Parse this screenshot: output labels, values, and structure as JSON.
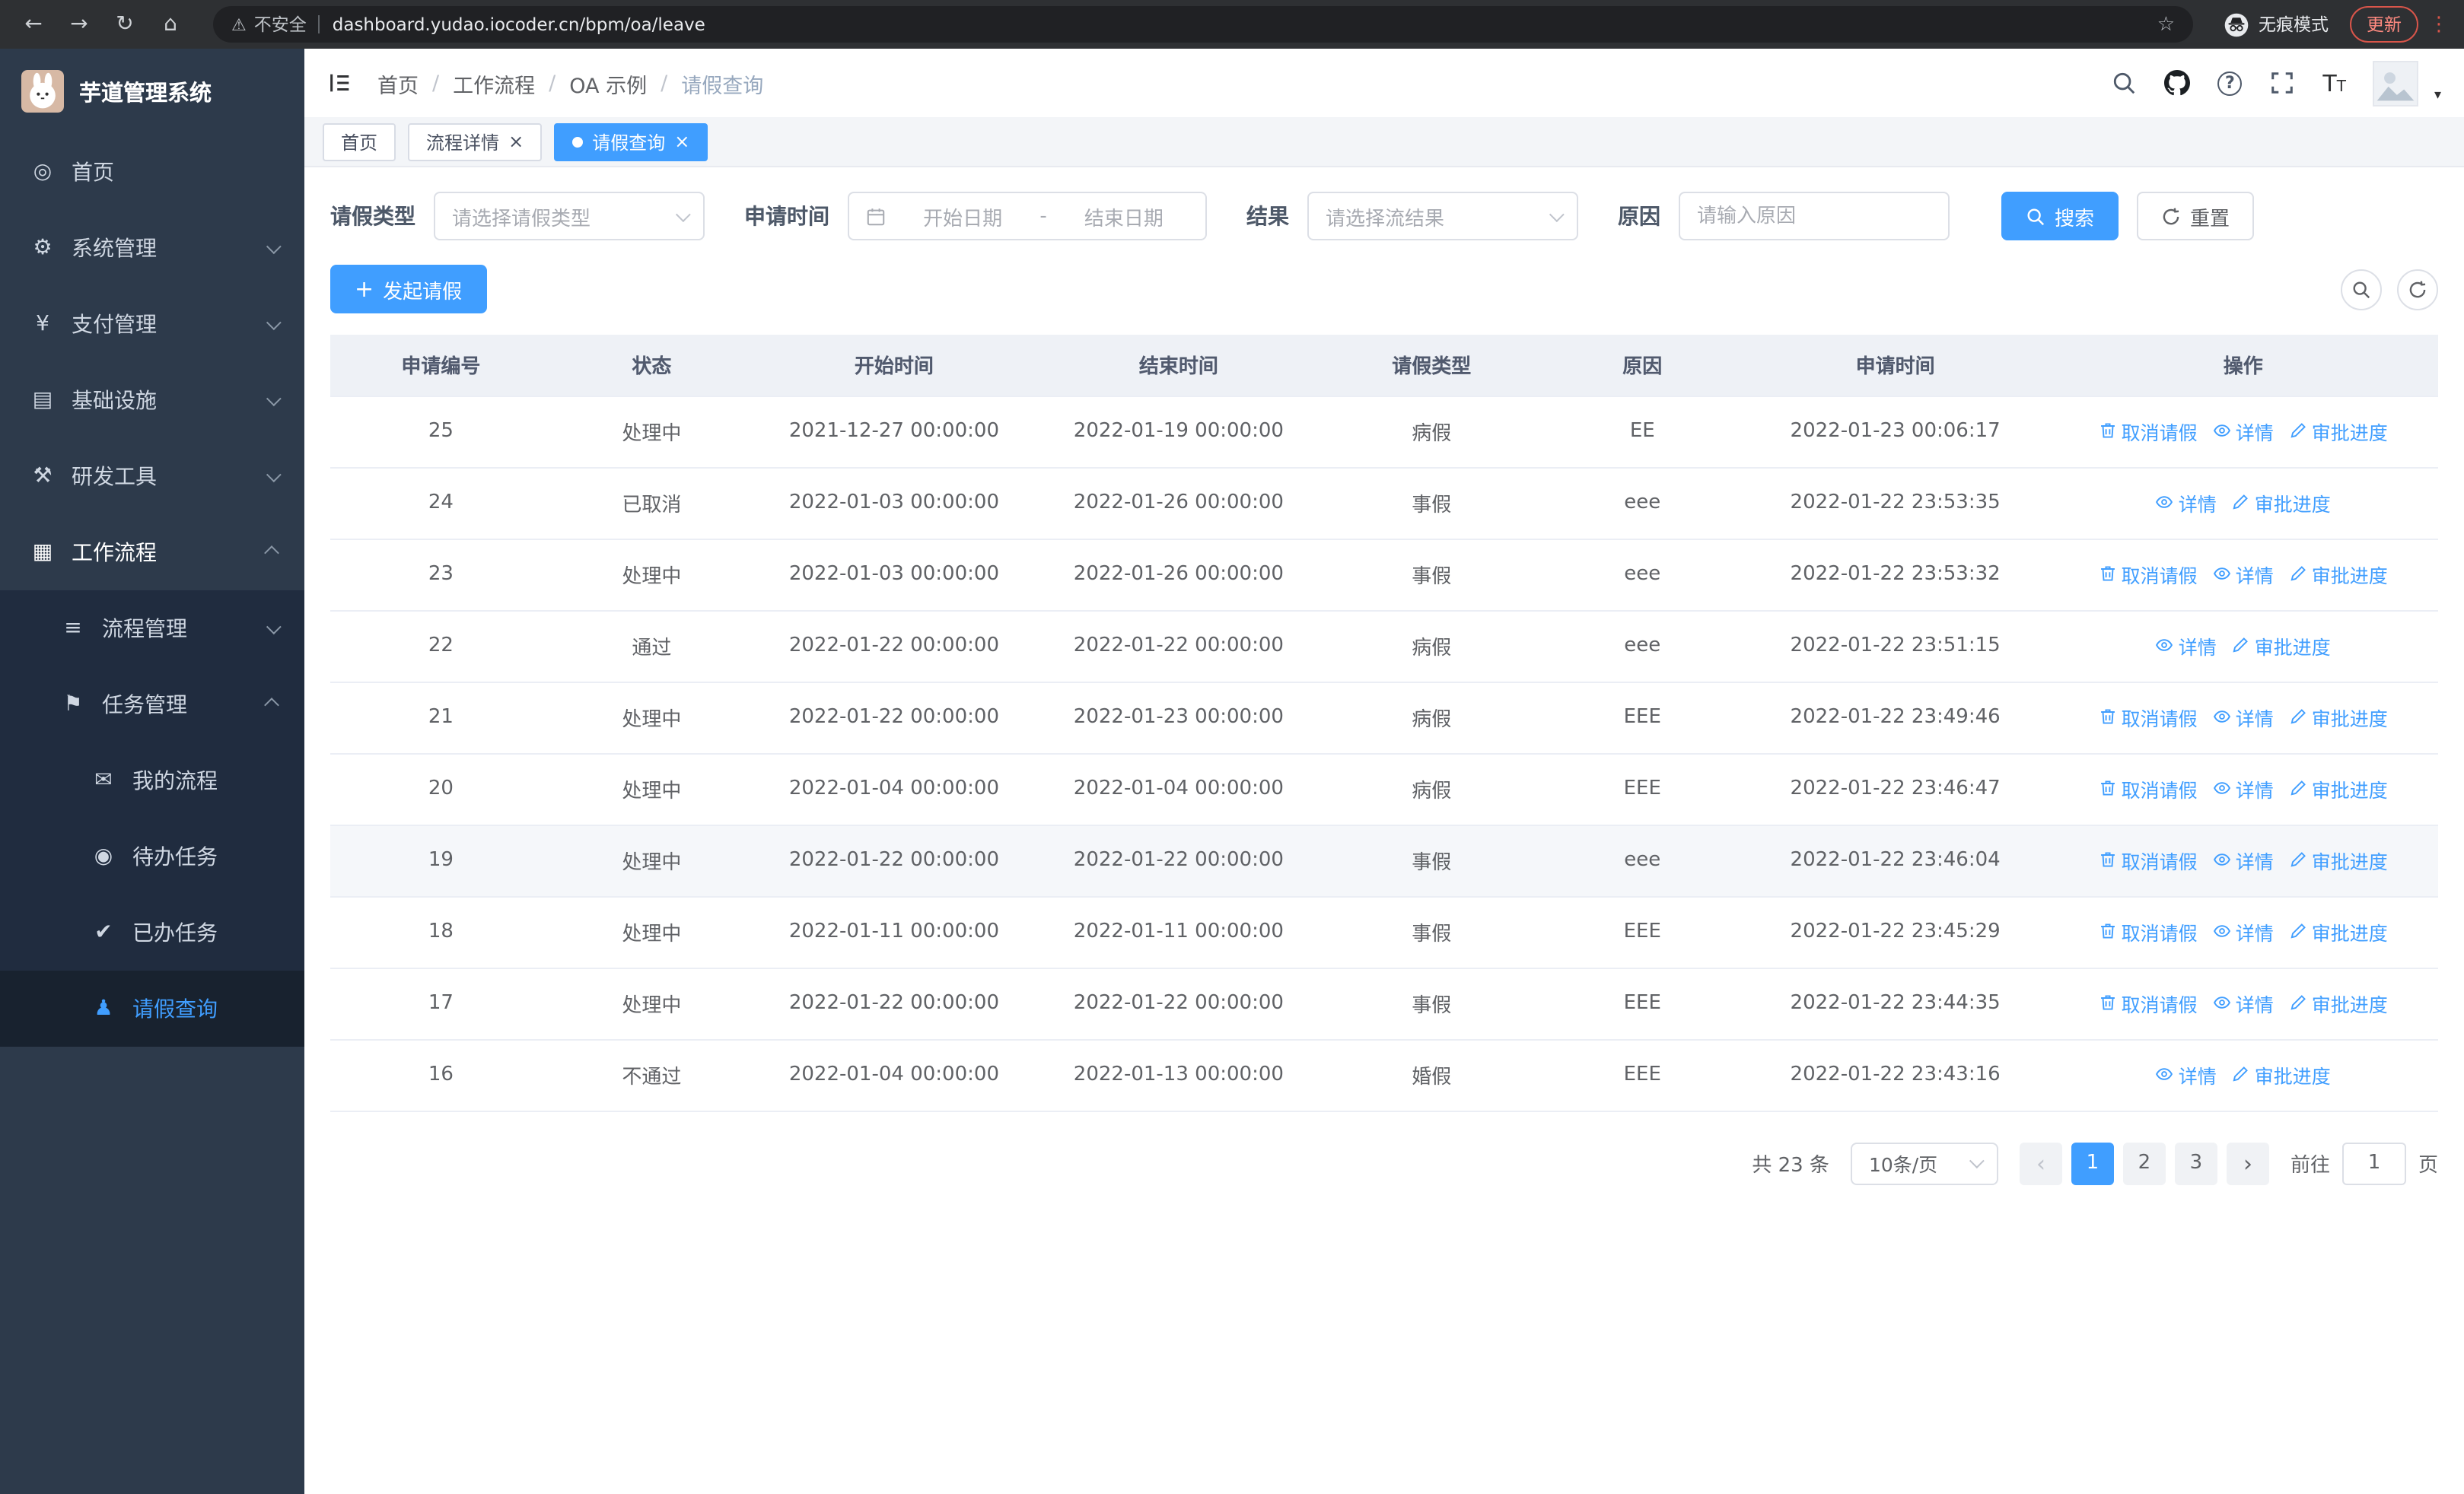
{
  "browser": {
    "security_label": "不安全",
    "url": "dashboard.yudao.iocoder.cn/bpm/oa/leave",
    "incognito_label": "无痕模式",
    "update_label": "更新"
  },
  "colors": {
    "primary": "#409eff",
    "sidebar_bg": "#2d3a4b",
    "sidebar_submenu_bg": "#202c3f",
    "update_red": "#d9554a"
  },
  "sidebar": {
    "logo_title": "芋道管理系统",
    "menu": [
      {
        "id": "home",
        "label": "首页",
        "icon": "dashboard-icon",
        "level": 1
      },
      {
        "id": "system",
        "label": "系统管理",
        "icon": "gear-icon",
        "level": 1,
        "chevron": "down"
      },
      {
        "id": "payment",
        "label": "支付管理",
        "icon": "yen-icon",
        "level": 1,
        "chevron": "down"
      },
      {
        "id": "infrastructure",
        "label": "基础设施",
        "icon": "infra-icon",
        "level": 1,
        "chevron": "down"
      },
      {
        "id": "devtools",
        "label": "研发工具",
        "icon": "tools-icon",
        "level": 1,
        "chevron": "down"
      },
      {
        "id": "workflow",
        "label": "工作流程",
        "icon": "workflow-icon",
        "level": 1,
        "chevron": "up",
        "trail": true
      },
      {
        "id": "process-mgmt",
        "label": "流程管理",
        "icon": "process-icon",
        "level": 2,
        "chevron": "down"
      },
      {
        "id": "task-mgmt",
        "label": "任务管理",
        "icon": "task-icon",
        "level": 2,
        "chevron": "up"
      },
      {
        "id": "my-process",
        "label": "我的流程",
        "icon": "chat-icon",
        "level": 3
      },
      {
        "id": "todo-tasks",
        "label": "待办任务",
        "icon": "eye-icon",
        "level": 3
      },
      {
        "id": "done-tasks",
        "label": "已办任务",
        "icon": "check-icon",
        "level": 3
      },
      {
        "id": "leave-query",
        "label": "请假查询",
        "icon": "user-icon",
        "level": 3,
        "active": true
      }
    ]
  },
  "header": {
    "breadcrumb": [
      "首页",
      "工作流程",
      "OA 示例",
      "请假查询"
    ]
  },
  "tabs": [
    {
      "id": "home",
      "label": "首页",
      "closable": false,
      "active": false
    },
    {
      "id": "process-detail",
      "label": "流程详情",
      "closable": true,
      "active": false
    },
    {
      "id": "leave-query",
      "label": "请假查询",
      "closable": true,
      "active": true
    }
  ],
  "filters": {
    "leave_type_label": "请假类型",
    "leave_type_placeholder": "请选择请假类型",
    "apply_time_label": "申请时间",
    "start_placeholder": "开始日期",
    "range_separator": "-",
    "end_placeholder": "结束日期",
    "result_label": "结果",
    "result_placeholder": "请选择流结果",
    "reason_label": "原因",
    "reason_placeholder": "请输入原因",
    "search_label": "搜索",
    "reset_label": "重置"
  },
  "toolbar": {
    "create_label": "发起请假"
  },
  "table": {
    "headers": [
      "申请编号",
      "状态",
      "开始时间",
      "结束时间",
      "请假类型",
      "原因",
      "申请时间",
      "操作"
    ],
    "action_labels": {
      "cancel": "取消请假",
      "detail": "详情",
      "progress": "审批进度"
    },
    "rows": [
      {
        "id": "25",
        "status": "处理中",
        "start": "2021-12-27 00:00:00",
        "end": "2022-01-19 00:00:00",
        "type": "病假",
        "reason": "EE",
        "applied": "2022-01-23 00:06:17",
        "actions": [
          "cancel",
          "detail",
          "progress"
        ]
      },
      {
        "id": "24",
        "status": "已取消",
        "start": "2022-01-03 00:00:00",
        "end": "2022-01-26 00:00:00",
        "type": "事假",
        "reason": "eee",
        "applied": "2022-01-22 23:53:35",
        "actions": [
          "detail",
          "progress"
        ]
      },
      {
        "id": "23",
        "status": "处理中",
        "start": "2022-01-03 00:00:00",
        "end": "2022-01-26 00:00:00",
        "type": "事假",
        "reason": "eee",
        "applied": "2022-01-22 23:53:32",
        "actions": [
          "cancel",
          "detail",
          "progress"
        ]
      },
      {
        "id": "22",
        "status": "通过",
        "start": "2022-01-22 00:00:00",
        "end": "2022-01-22 00:00:00",
        "type": "病假",
        "reason": "eee",
        "applied": "2022-01-22 23:51:15",
        "actions": [
          "detail",
          "progress"
        ]
      },
      {
        "id": "21",
        "status": "处理中",
        "start": "2022-01-22 00:00:00",
        "end": "2022-01-23 00:00:00",
        "type": "病假",
        "reason": "EEE",
        "applied": "2022-01-22 23:49:46",
        "actions": [
          "cancel",
          "detail",
          "progress"
        ]
      },
      {
        "id": "20",
        "status": "处理中",
        "start": "2022-01-04 00:00:00",
        "end": "2022-01-04 00:00:00",
        "type": "病假",
        "reason": "EEE",
        "applied": "2022-01-22 23:46:47",
        "actions": [
          "cancel",
          "detail",
          "progress"
        ]
      },
      {
        "id": "19",
        "status": "处理中",
        "start": "2022-01-22 00:00:00",
        "end": "2022-01-22 00:00:00",
        "type": "事假",
        "reason": "eee",
        "applied": "2022-01-22 23:46:04",
        "actions": [
          "cancel",
          "detail",
          "progress"
        ],
        "highlighted": true
      },
      {
        "id": "18",
        "status": "处理中",
        "start": "2022-01-11 00:00:00",
        "end": "2022-01-11 00:00:00",
        "type": "事假",
        "reason": "EEE",
        "applied": "2022-01-22 23:45:29",
        "actions": [
          "cancel",
          "detail",
          "progress"
        ]
      },
      {
        "id": "17",
        "status": "处理中",
        "start": "2022-01-22 00:00:00",
        "end": "2022-01-22 00:00:00",
        "type": "事假",
        "reason": "EEE",
        "applied": "2022-01-22 23:44:35",
        "actions": [
          "cancel",
          "detail",
          "progress"
        ]
      },
      {
        "id": "16",
        "status": "不通过",
        "start": "2022-01-04 00:00:00",
        "end": "2022-01-13 00:00:00",
        "type": "婚假",
        "reason": "EEE",
        "applied": "2022-01-22 23:43:16",
        "actions": [
          "detail",
          "progress"
        ]
      }
    ]
  },
  "pagination": {
    "total_label": "共 23 条",
    "page_size_label": "10条/页",
    "pages": [
      "1",
      "2",
      "3"
    ],
    "active_page": "1",
    "goto_label": "前往",
    "goto_value": "1",
    "goto_suffix": "页"
  }
}
